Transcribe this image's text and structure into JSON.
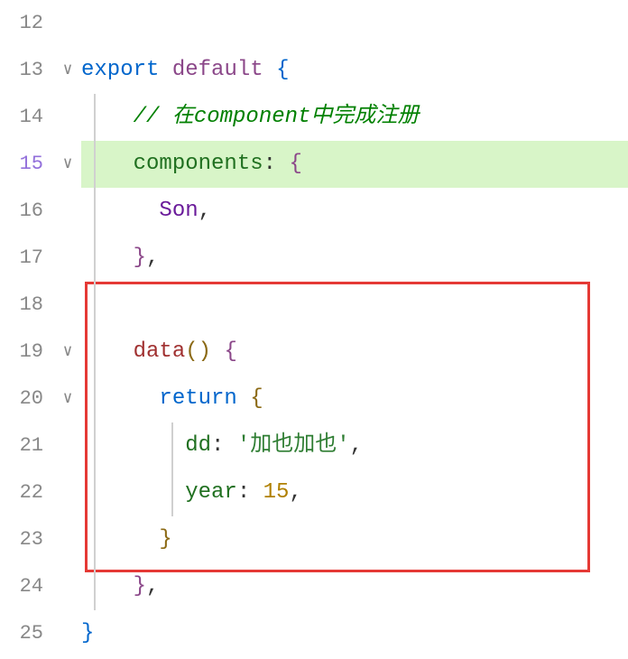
{
  "lines": {
    "12": {
      "num": "12"
    },
    "13": {
      "num": "13",
      "fold": "∨"
    },
    "14": {
      "num": "14"
    },
    "15": {
      "num": "15",
      "fold": "∨"
    },
    "16": {
      "num": "16"
    },
    "17": {
      "num": "17"
    },
    "18": {
      "num": "18"
    },
    "19": {
      "num": "19",
      "fold": "∨"
    },
    "20": {
      "num": "20",
      "fold": "∨"
    },
    "21": {
      "num": "21"
    },
    "22": {
      "num": "22"
    },
    "23": {
      "num": "23"
    },
    "24": {
      "num": "24"
    },
    "25": {
      "num": "25"
    }
  },
  "code": {
    "l13": {
      "export": "export",
      "default": "default",
      "brace": "{"
    },
    "l14": {
      "comment": "// 在component中完成注册"
    },
    "l15": {
      "key": "components",
      "colon": ":",
      "brace": "{"
    },
    "l16": {
      "ident": "Son",
      "comma": ","
    },
    "l17": {
      "brace": "}",
      "comma": ","
    },
    "l19": {
      "method": "data",
      "parens": "()",
      "brace": "{"
    },
    "l20": {
      "return": "return",
      "brace": "{"
    },
    "l21": {
      "key": "dd",
      "colon": ":",
      "string": "'加也加也'",
      "comma": ","
    },
    "l22": {
      "key": "year",
      "colon": ":",
      "number": "15",
      "comma": ","
    },
    "l23": {
      "brace": "}"
    },
    "l24": {
      "brace": "}",
      "comma": ","
    },
    "l25": {
      "brace": "}"
    }
  }
}
